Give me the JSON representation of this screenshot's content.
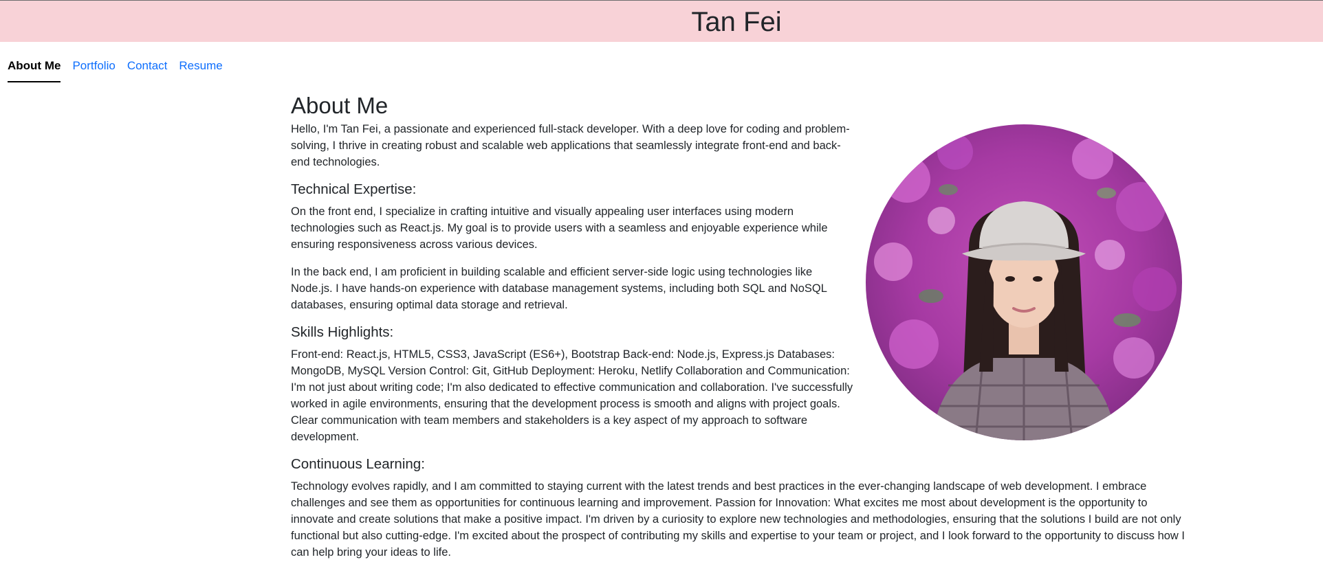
{
  "header": {
    "title": "Tan Fei"
  },
  "nav": {
    "tabs": [
      {
        "label": "About Me",
        "active": true
      },
      {
        "label": "Portfolio",
        "active": false
      },
      {
        "label": "Contact",
        "active": false
      },
      {
        "label": "Resume",
        "active": false
      }
    ]
  },
  "about": {
    "title": "About Me",
    "intro": "Hello, I'm Tan Fei, a passionate and experienced full-stack developer. With a deep love for coding and problem-solving, I thrive in creating robust and scalable web applications that seamlessly integrate front-end and back-end technologies.",
    "technical_heading": "Technical Expertise:",
    "technical_p1": "On the front end, I specialize in crafting intuitive and visually appealing user interfaces using modern technologies such as React.js. My goal is to provide users with a seamless and enjoyable experience while ensuring responsiveness across various devices.",
    "technical_p2": "In the back end, I am proficient in building scalable and efficient server-side logic using technologies like Node.js. I have hands-on experience with database management systems, including both SQL and NoSQL databases, ensuring optimal data storage and retrieval.",
    "skills_heading": "Skills Highlights:",
    "skills_p": "Front-end: React.js, HTML5, CSS3, JavaScript (ES6+), Bootstrap Back-end: Node.js, Express.js Databases: MongoDB, MySQL Version Control: Git, GitHub Deployment: Heroku, Netlify Collaboration and Communication: I'm not just about writing code; I'm also dedicated to effective communication and collaboration. I've successfully worked in agile environments, ensuring that the development process is smooth and aligns with project goals. Clear communication with team members and stakeholders is a key aspect of my approach to software development.",
    "learning_heading": "Continuous Learning:",
    "learning_p": "Technology evolves rapidly, and I am committed to staying current with the latest trends and best practices in the ever-changing landscape of web development. I embrace challenges and see them as opportunities for continuous learning and improvement. Passion for Innovation: What excites me most about development is the opportunity to innovate and create solutions that make a positive impact. I'm driven by a curiosity to explore new technologies and methodologies, ensuring that the solutions I build are not only functional but also cutting-edge. I'm excited about the prospect of contributing my skills and expertise to your team or project, and I look forward to the opportunity to discuss how I can help bring your ideas to life."
  },
  "colors": {
    "header_bg": "#f8d2d7",
    "link": "#0d6efd",
    "text": "#212529"
  }
}
